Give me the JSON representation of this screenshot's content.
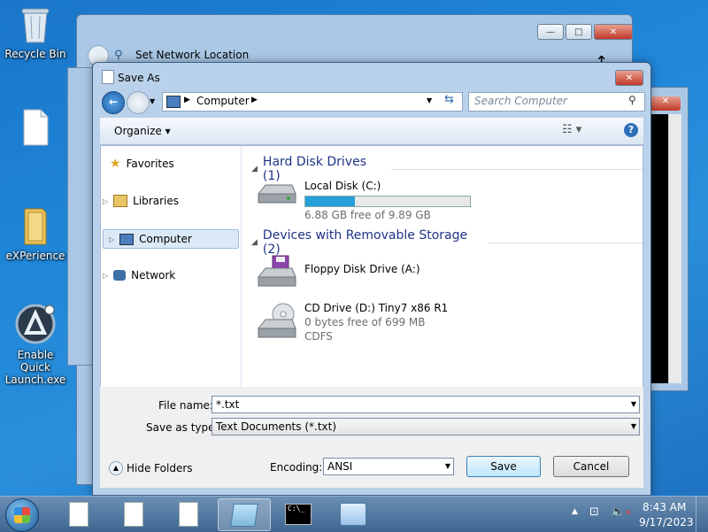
{
  "desktop": {
    "icons": [
      {
        "label": "Recycle Bin"
      },
      {
        "label": "eXPerience"
      },
      {
        "label": "Enable Quick Launch.exe"
      }
    ]
  },
  "back_window": {
    "title": "Set Network Location",
    "buttons": {
      "minimize": "—",
      "maximize": "□",
      "close": "✕"
    }
  },
  "dialog": {
    "title": "Save As",
    "close": "✕",
    "address": {
      "root_label": "Computer"
    },
    "search_placeholder": "Search Computer",
    "toolbar": {
      "organize": "Organize",
      "help": "?"
    },
    "nav_items": [
      {
        "label": "Favorites"
      },
      {
        "label": "Libraries"
      },
      {
        "label": "Computer"
      },
      {
        "label": "Network"
      }
    ],
    "groups": {
      "hdd": {
        "title": "Hard Disk Drives (1)"
      },
      "removable": {
        "title": "Devices with Removable Storage (2)"
      }
    },
    "drives": {
      "c": {
        "name": "Local Disk (C:)",
        "free": "6.88 GB free of 9.89 GB",
        "used_fraction": 0.3
      },
      "a": {
        "name": "Floppy Disk Drive (A:)"
      },
      "d": {
        "name": "CD Drive (D:) Tiny7 x86 R1",
        "free": "0 bytes free of 699 MB",
        "fs": "CDFS"
      }
    },
    "form": {
      "filename_label": "File name:",
      "filename_value": "*.txt",
      "type_label": "Save as type:",
      "type_value": "Text Documents (*.txt)",
      "hide_folders": "Hide Folders",
      "encoding_label": "Encoding:",
      "encoding_value": "ANSI",
      "save": "Save",
      "cancel": "Cancel"
    }
  },
  "taskbar": {
    "time": "8:43 AM",
    "date": "9/17/2023",
    "cmd_label": "C:\\_"
  },
  "colors": {
    "accent": "#1e3287",
    "drive_bar": "#26a0da"
  }
}
